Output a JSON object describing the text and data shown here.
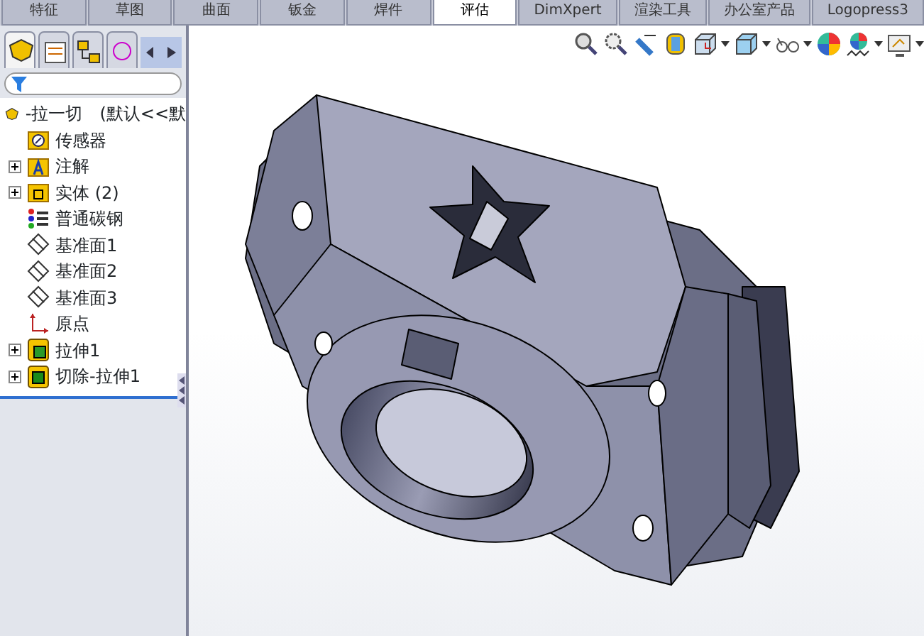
{
  "command_tabs": [
    {
      "label": "特征",
      "selected": false
    },
    {
      "label": "草图",
      "selected": false
    },
    {
      "label": "曲面",
      "selected": false
    },
    {
      "label": "钣金",
      "selected": false
    },
    {
      "label": "焊件",
      "selected": false
    },
    {
      "label": "评估",
      "selected": true
    },
    {
      "label": "DimXpert",
      "selected": false
    },
    {
      "label": "渲染工具",
      "selected": false
    },
    {
      "label": "办公室产品",
      "selected": false
    },
    {
      "label": "Logopress3",
      "selected": false
    }
  ],
  "manager_tabs": [
    {
      "kind": "feature",
      "selected": true
    },
    {
      "kind": "property",
      "selected": false
    },
    {
      "kind": "config",
      "selected": false
    },
    {
      "kind": "other",
      "selected": false
    }
  ],
  "feature_tree": {
    "root": "-拉一切　(默认<<默",
    "items": [
      {
        "label": "传感器",
        "kind": "sensor",
        "expandable": false
      },
      {
        "label": "注解",
        "kind": "annotation",
        "expandable": true
      },
      {
        "label": "实体 (2)",
        "kind": "solid",
        "expandable": true
      },
      {
        "label": "普通碳钢",
        "kind": "material",
        "expandable": false
      },
      {
        "label": "基准面1",
        "kind": "plane",
        "expandable": false
      },
      {
        "label": "基准面2",
        "kind": "plane",
        "expandable": false
      },
      {
        "label": "基准面3",
        "kind": "plane",
        "expandable": false
      },
      {
        "label": "原点",
        "kind": "origin",
        "expandable": false
      },
      {
        "label": "拉伸1",
        "kind": "extrude",
        "expandable": true
      },
      {
        "label": "切除-拉伸1",
        "kind": "cut",
        "expandable": true
      }
    ]
  },
  "view_toolbar": [
    {
      "kind": "zoom-fit",
      "dropdown": false
    },
    {
      "kind": "zoom-area",
      "dropdown": false
    },
    {
      "kind": "previous",
      "dropdown": false
    },
    {
      "kind": "section",
      "dropdown": false
    },
    {
      "kind": "orientation",
      "dropdown": true
    },
    {
      "kind": "display",
      "dropdown": true
    },
    {
      "kind": "hide",
      "dropdown": true
    },
    {
      "kind": "appearance",
      "dropdown": false
    },
    {
      "kind": "scene",
      "dropdown": true
    },
    {
      "kind": "settings",
      "dropdown": true
    }
  ]
}
